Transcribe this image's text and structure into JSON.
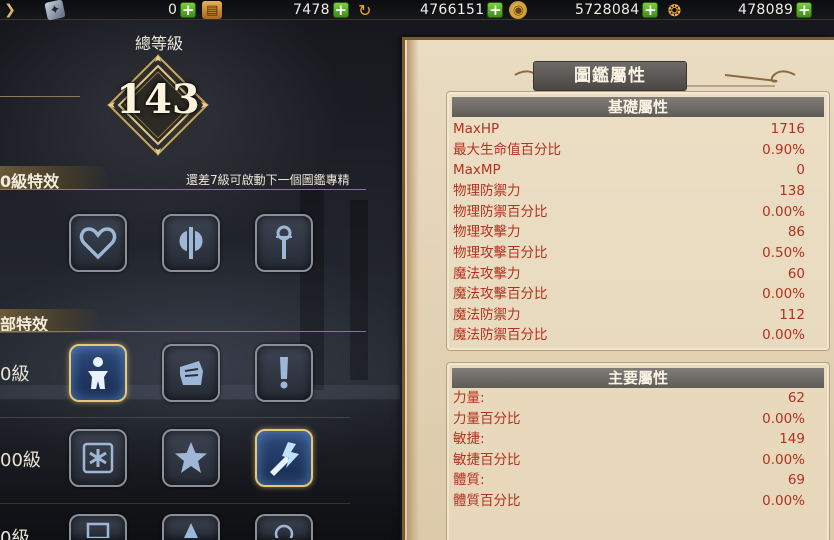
{
  "currency_bar": {
    "items": [
      {
        "value": "0",
        "icon": "scroll-icon"
      },
      {
        "value": "7478",
        "icon": "swirl-icon"
      },
      {
        "value": "4766151",
        "icon": "gold-coin-icon"
      },
      {
        "value": "5728084",
        "icon": "shell-icon"
      },
      {
        "value": "478089",
        "icon": null
      }
    ],
    "plus_label": "+"
  },
  "left": {
    "level_label": "總等級",
    "level_value": "143",
    "section1_title": "0級特效",
    "hint": "還差7級可啟動下一個圖鑑專精",
    "section2_title": "部特效",
    "row_labels": [
      "0級",
      "00級",
      "0級"
    ],
    "skills_row1": [
      {
        "icon": "heart-icon",
        "active": false
      },
      {
        "icon": "axe-icon",
        "active": false
      },
      {
        "icon": "staff-icon",
        "active": false
      }
    ],
    "skills_row2": [
      {
        "icon": "figure-icon",
        "active": true
      },
      {
        "icon": "fist-icon",
        "active": false
      },
      {
        "icon": "gem-icon",
        "active": false
      }
    ],
    "skills_row3": [
      {
        "icon": "snowflake-icon",
        "active": false
      },
      {
        "icon": "star-icon",
        "active": false
      },
      {
        "icon": "lightning-sword-icon",
        "active": true
      }
    ]
  },
  "panel": {
    "title": "圖鑑屬性",
    "basic": {
      "header": "基礎屬性",
      "stats": [
        {
          "name": "MaxHP",
          "value": "1716"
        },
        {
          "name": "最大生命值百分比",
          "value": "0.90%"
        },
        {
          "name": "MaxMP",
          "value": "0"
        },
        {
          "name": "物理防禦力",
          "value": "138"
        },
        {
          "name": "物理防禦百分比",
          "value": "0.00%"
        },
        {
          "name": "物理攻擊力",
          "value": "86"
        },
        {
          "name": "物理攻擊百分比",
          "value": "0.50%"
        },
        {
          "name": "魔法攻擊力",
          "value": "60"
        },
        {
          "name": "魔法攻擊百分比",
          "value": "0.00%"
        },
        {
          "name": "魔法防禦力",
          "value": "112"
        },
        {
          "name": "魔法防禦百分比",
          "value": "0.00%"
        }
      ]
    },
    "main": {
      "header": "主要屬性",
      "stats": [
        {
          "name": "力量:",
          "value": "62"
        },
        {
          "name": "力量百分比",
          "value": "0.00%"
        },
        {
          "name": "敏捷:",
          "value": "149"
        },
        {
          "name": "敏捷百分比",
          "value": "0.00%"
        },
        {
          "name": "體質:",
          "value": "69"
        },
        {
          "name": "體質百分比",
          "value": "0.00%"
        }
      ]
    }
  },
  "colors": {
    "stat_text": "#b3311f",
    "parchment": "#e6d7ba",
    "header_gray": "#6b6864",
    "accent_gold": "#e6c87a"
  }
}
